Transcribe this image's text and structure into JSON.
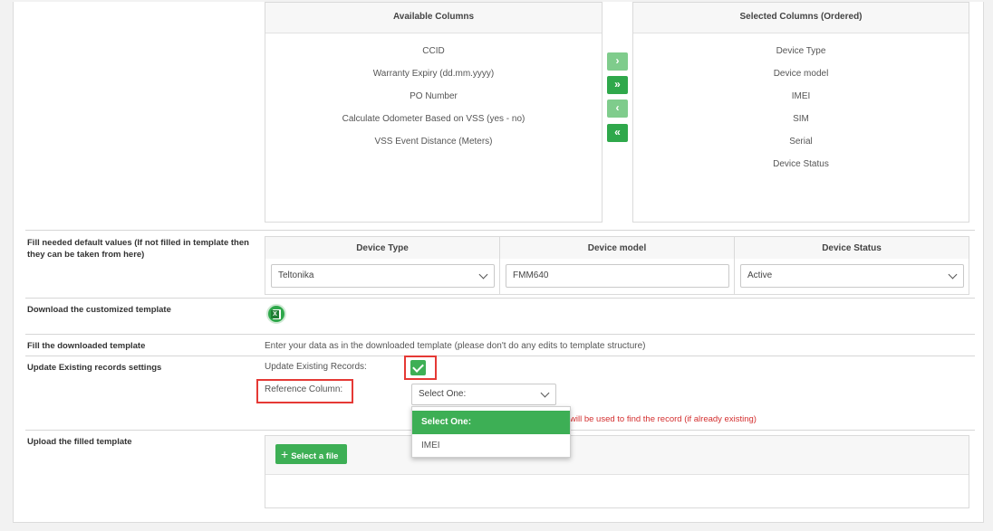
{
  "available_columns": {
    "title": "Available Columns",
    "items": [
      "CCID",
      "Warranty Expiry (dd.mm.yyyy)",
      "PO Number",
      "Calculate Odometer Based on VSS (yes - no)",
      "VSS Event Distance (Meters)"
    ]
  },
  "selected_columns": {
    "title": "Selected Columns (Ordered)",
    "items": [
      "Device Type",
      "Device model",
      "IMEI",
      "SIM",
      "Serial",
      "Device Status"
    ]
  },
  "transfer_buttons": {
    "move_right": "›",
    "move_all_right": "»",
    "move_left": "‹",
    "move_all_left": "«"
  },
  "defaults": {
    "label": "Fill needed default values (If not filled in template then they can be taken from here)",
    "device_type": {
      "header": "Device Type",
      "value": "Teltonika"
    },
    "device_model": {
      "header": "Device model",
      "value": "FMM640"
    },
    "device_status": {
      "header": "Device Status",
      "value": "Active"
    }
  },
  "download": {
    "label": "Download the customized template",
    "icon": "excel-icon",
    "icon_text": "X"
  },
  "fill": {
    "label": "Fill the downloaded template",
    "hint": "Enter your data as in the downloaded template (please don't do any edits to template structure)"
  },
  "update": {
    "label": "Update Existing records settings",
    "update_existing_label": "Update Existing Records:",
    "update_existing_checked": true,
    "reference_label": "Reference Column:",
    "reference_value": "Select One:",
    "reference_hint": "will be used to find the record (if already existing)",
    "options": [
      "Select One:",
      "IMEI"
    ]
  },
  "upload": {
    "label": "Upload the filled template",
    "button_label": "Select a file",
    "button_icon": "+"
  },
  "colors": {
    "accent": "#2fa84b",
    "accent_light": "#7fcc8c",
    "highlight": "#e53935",
    "error_text": "#d32f2f"
  }
}
